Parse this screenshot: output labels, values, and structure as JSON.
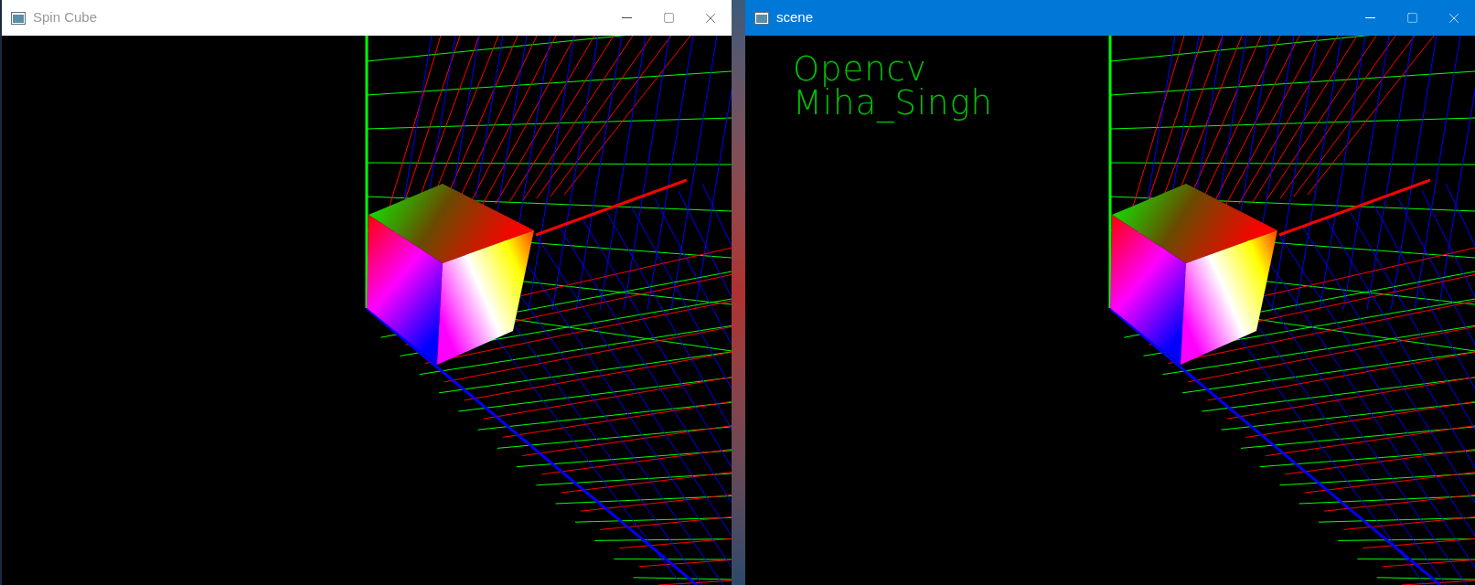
{
  "windows": [
    {
      "title": "Spin Cube",
      "active": false
    },
    {
      "title": "scene",
      "active": true,
      "overlay_text": [
        "Opencv",
        "Miha_Singh"
      ]
    }
  ]
}
